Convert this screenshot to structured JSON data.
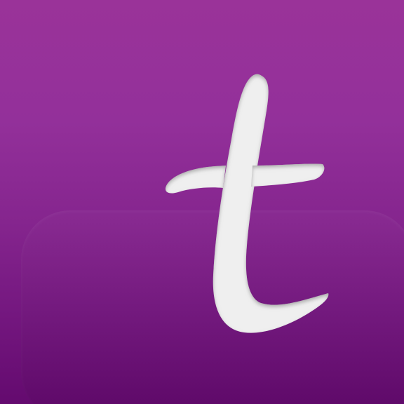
{
  "app_icon": {
    "letter": "t",
    "background_top_color": "#9a3399",
    "background_bottom_color": "#640a6f",
    "glyph_color": "#efefef"
  }
}
